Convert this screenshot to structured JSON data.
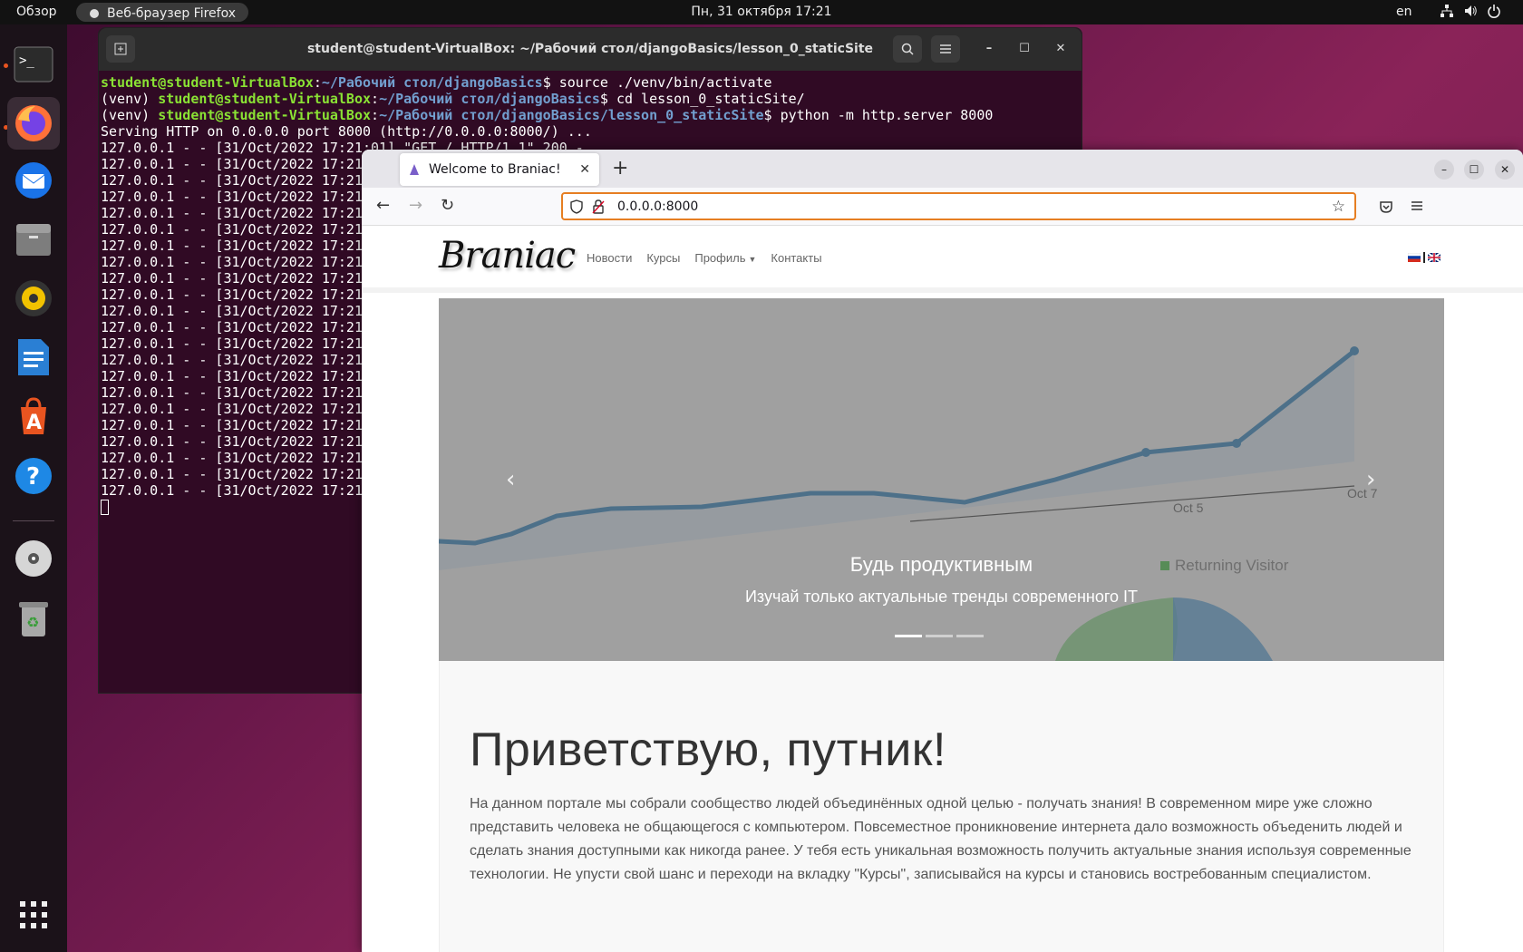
{
  "topbar": {
    "overview": "Обзор",
    "active_app": "Веб-браузер Firefox",
    "clock": "Пн, 31 октября  17:21",
    "lang": "en"
  },
  "dock": {
    "items": [
      "terminal-icon",
      "firefox-icon",
      "thunderbird-icon",
      "files-icon",
      "rhythmbox-icon",
      "writer-icon",
      "app-center-icon",
      "help-icon",
      "dvd-icon",
      "trash-icon",
      "app-grid-icon"
    ]
  },
  "terminal": {
    "title": "student@student-VirtualBox: ~/Рабочий стол/djangoBasics/lesson_0_staticSite",
    "lines": [
      {
        "user": "student@student-VirtualBox",
        "path": "~/Рабочий стол/djangoBasics",
        "cmd": "$ source ./venv/bin/activate",
        "prefix": ""
      },
      {
        "user": "student@student-VirtualBox",
        "path": "~/Рабочий стол/djangoBasics",
        "cmd": "$ cd lesson_0_staticSite/",
        "prefix": "(venv) "
      },
      {
        "user": "student@student-VirtualBox",
        "path": "~/Рабочий стол/djangoBasics/lesson_0_staticSite",
        "cmd": "$ python -m http.server 8000",
        "prefix": "(venv) "
      }
    ],
    "serving": "Serving HTTP on 0.0.0.0 port 8000 (http://0.0.0.0:8000/) ...",
    "first_log": "127.0.0.1 - - [31/Oct/2022 17:21:01] \"GET / HTTP/1.1\" 200 -",
    "log_line": "127.0.0.1 - - [31/Oct/2022 17:21",
    "log_count": 21
  },
  "firefox": {
    "tab_title": "Welcome to Braniac!",
    "url": "0.0.0.0:8000"
  },
  "site": {
    "brand": "Braniac",
    "nav": [
      "Новости",
      "Курсы",
      "Профиль",
      "Контакты"
    ],
    "carousel": {
      "caption_title": "Будь продуктивным",
      "caption_sub": "Изучай только актуальные тренды современного IT",
      "slides": 3,
      "active": 0,
      "bg_labels": [
        "Oct 5",
        "Oct 7",
        "Returning Visitor"
      ]
    },
    "heading": "Приветствую, путник!",
    "paragraph": "На данном портале мы собрали сообщество людей объединённых одной целью - получать знания! В современном мире уже сложно представить человека не общающегося с компьютером. Повсеместное проникновение интернета дало возможность объеденить людей и сделать знания доступными как никогда ранее. У тебя есть уникальная возможность получить актуальные знания используя современные технологии. Не упусти свой шанс и переходи на вкладку \"Курсы\", записывайся на курсы и становись востребованным специалистом."
  }
}
